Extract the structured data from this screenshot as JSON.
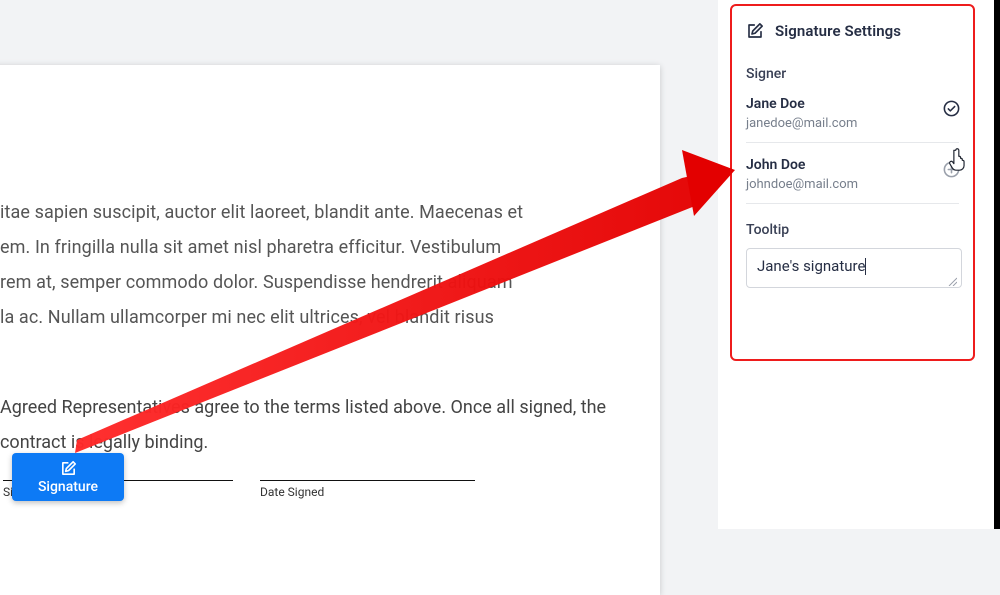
{
  "doc": {
    "para_lines": [
      "itae sapien suscipit, auctor elit laoreet, blandit ante. Maecenas et",
      "em. In fringilla nulla sit amet nisl pharetra efficitur. Vestibulum",
      "rem at, semper commodo dolor. Suspendisse hendrerit aliquam",
      "la ac. Nullam ullamcorper mi nec elit ultrices, vel blandit risus"
    ],
    "agree_lines": [
      "Agreed Representatives agree to the terms listed above. Once all",
      "signed, the contract is legally binding."
    ],
    "sig_field_labels": {
      "signature": "Signature",
      "date_signed": "Date Signed"
    }
  },
  "sig_button": {
    "label": "Signature"
  },
  "panel": {
    "title": "Signature Settings",
    "signer_section_label": "Signer",
    "tooltip_label": "Tooltip",
    "tooltip_value": "Jane's signature",
    "signers": [
      {
        "name": "Jane Doe",
        "email": "janedoe@mail.com",
        "action": "check"
      },
      {
        "name": "John Doe",
        "email": "johndoe@mail.com",
        "action": "plus"
      }
    ]
  }
}
